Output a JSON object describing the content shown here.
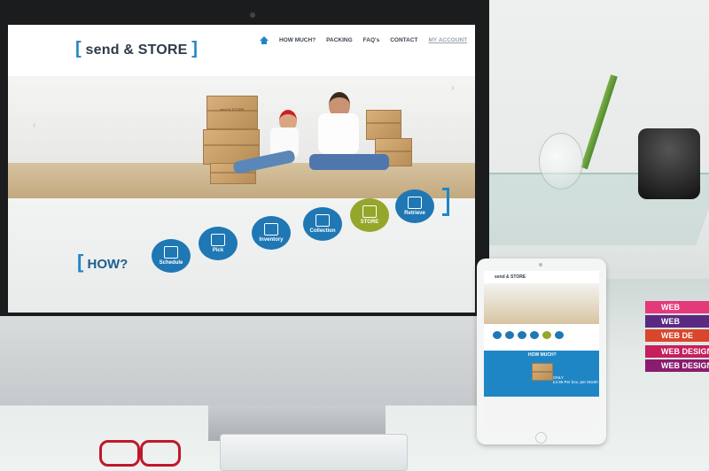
{
  "website": {
    "logo_text": "send & STORE",
    "logo_bracket_left": "[",
    "logo_bracket_right": "]",
    "nav": [
      "HOW MUCH?",
      "PACKING",
      "FAQ's",
      "CONTACT",
      "MY ACCOUNT"
    ],
    "hero_box_label": "send & STORE",
    "how_label": "HOW?",
    "steps": [
      {
        "label": "Schedule",
        "icon": "calendar-icon"
      },
      {
        "label": "Pick",
        "icon": "boxes-icon"
      },
      {
        "label": "Inventory",
        "icon": "checklist-icon"
      },
      {
        "label": "Collection",
        "icon": "truck-icon"
      },
      {
        "label": "STORE",
        "icon": "box-icon",
        "active": true
      },
      {
        "label": "Retrieve",
        "icon": "retrieve-box-icon"
      }
    ],
    "arrow_left": "‹",
    "arrow_right": "›"
  },
  "ipad_site": {
    "logo_text": "send & STORE",
    "how_much": "HOW MUCH?",
    "price_line1": "ONLY",
    "price_line2": "£4.95 Per box, per Month"
  },
  "books": [
    "WEB DESIGN",
    "WEB DE",
    "WEB",
    "WEB"
  ],
  "colors": {
    "brand_blue": "#1f86c6",
    "step_blue": "#1f77b4",
    "active_green": "#96a62a",
    "dark_text": "#2f3b4a"
  }
}
